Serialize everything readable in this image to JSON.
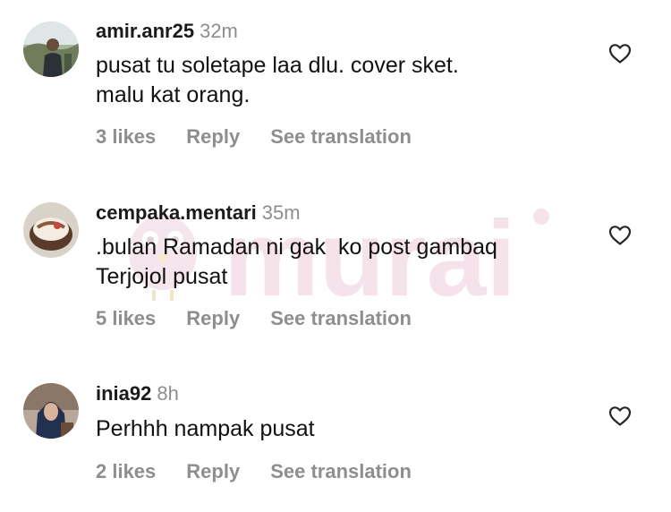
{
  "watermark": {
    "text": "murai"
  },
  "comments": [
    {
      "username": "amir.anr25",
      "time": "32m",
      "text": "pusat tu soletape laa dlu. cover sket.\nmalu kat orang.",
      "likes": "3 likes",
      "reply": "Reply",
      "translate": "See translation",
      "avatar_icon": "avatar-outdoor-photo"
    },
    {
      "username": "cempaka.mentari",
      "time": "35m",
      "text": ".bulan Ramadan ni gak  ko post gambaq\nTerjojol pusat",
      "likes": "5 likes",
      "reply": "Reply",
      "translate": "See translation",
      "avatar_icon": "avatar-dessert-photo"
    },
    {
      "username": "inia92",
      "time": "8h",
      "text": "Perhhh nampak pusat",
      "likes": "2 likes",
      "reply": "Reply",
      "translate": "See translation",
      "avatar_icon": "avatar-person-photo"
    }
  ],
  "colors": {
    "text": "#111111",
    "muted": "#8e8e8e",
    "watermark": "#f3d6e3"
  },
  "icons": {
    "like": "heart-outline-icon"
  }
}
